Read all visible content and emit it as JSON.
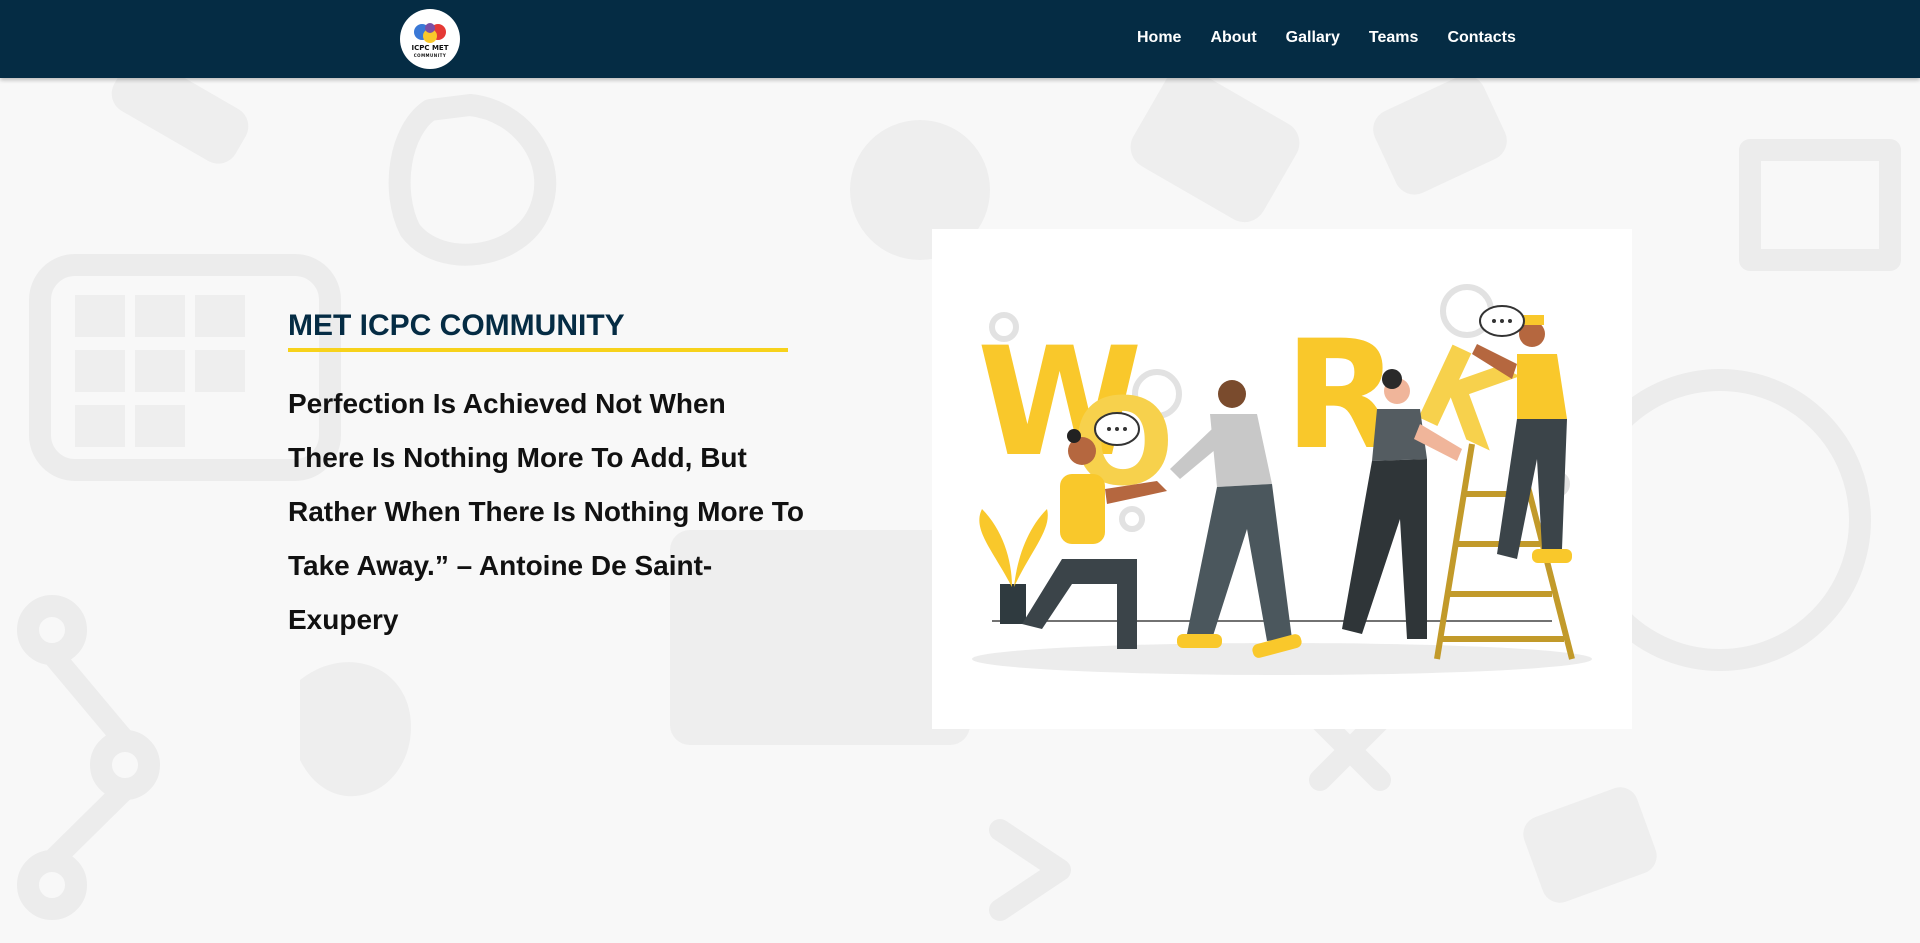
{
  "header": {
    "logo": {
      "line1": "ICPC MET",
      "line2": "COMMUNITY"
    },
    "nav": [
      {
        "label": "Home"
      },
      {
        "label": "About"
      },
      {
        "label": "Gallary"
      },
      {
        "label": "Teams"
      },
      {
        "label": "Contacts"
      }
    ]
  },
  "hero": {
    "title": "MET ICPC COMMUNITY",
    "quote": "Perfection Is Achieved Not When There Is Nothing More To Add, But Rather When There Is Nothing More To Take Away.” – Antoine De Saint-Exupery",
    "illustration": {
      "letters": [
        "W",
        "O",
        "R",
        "K"
      ]
    }
  },
  "colors": {
    "navbar": "#052c44",
    "title": "#052c44",
    "accent": "#f7d21b",
    "background": "#f8f8f8"
  }
}
